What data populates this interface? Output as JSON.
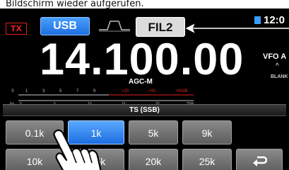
{
  "caption": "Bildschirm wieder aufgerufen.",
  "status": {
    "tx": "TX",
    "mode": "USB",
    "filter": "FIL2",
    "clock": "12:0",
    "vfo_line1": "VFO A",
    "vfo_line2": "^",
    "blank_label": "BLANK"
  },
  "frequency": "14.100.00",
  "agc": "AGC-M",
  "meter": {
    "s_scale": [
      "S",
      "1",
      "3",
      "5",
      "7",
      "9",
      "+20",
      "+40",
      "+60dB"
    ],
    "po_scale": [
      "Po",
      "0",
      "5",
      "10",
      "15",
      "20",
      "25W"
    ]
  },
  "ts_title": "TS (SSB)",
  "ts_buttons": [
    {
      "label": "0.1k",
      "selected": false
    },
    {
      "label": "1k",
      "selected": true
    },
    {
      "label": "5k",
      "selected": false
    },
    {
      "label": "9k",
      "selected": false
    },
    {
      "label": "10k",
      "selected": false
    },
    {
      "label": "2.5k",
      "selected": false
    },
    {
      "label": "20k",
      "selected": false
    },
    {
      "label": "25k",
      "selected": false
    }
  ],
  "back_icon": "return-arrow-icon",
  "colors": {
    "tx": "#e02020",
    "selected": "#2a80f0",
    "button": "#6e6e6e",
    "meter_red": "#e02020"
  }
}
